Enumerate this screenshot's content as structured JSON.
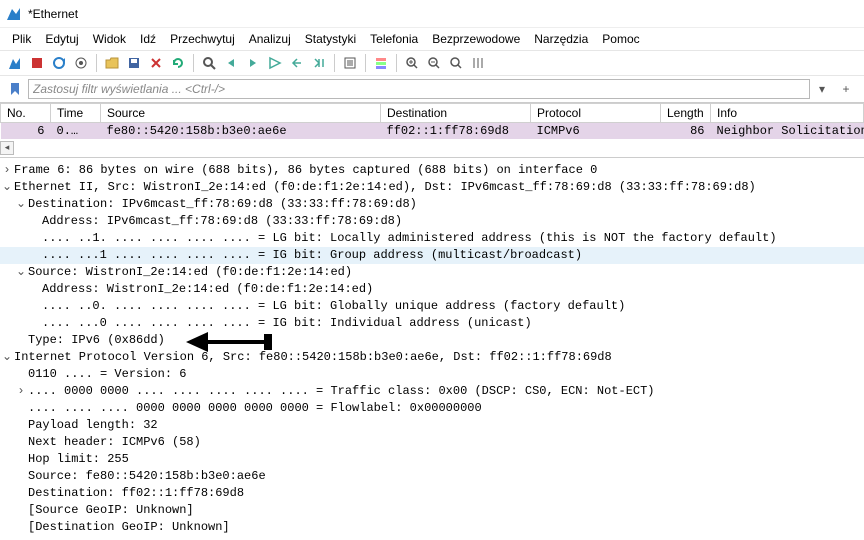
{
  "window": {
    "title": "*Ethernet"
  },
  "menu": {
    "items": [
      "Plik",
      "Edytuj",
      "Widok",
      "Idź",
      "Przechwytuj",
      "Analizuj",
      "Statystyki",
      "Telefonia",
      "Bezprzewodowe",
      "Narzędzia",
      "Pomoc"
    ]
  },
  "filter": {
    "placeholder": "Zastosuj filtr wyświetlania ... <Ctrl-/>"
  },
  "packet_table": {
    "headers": {
      "no": "No.",
      "time": "Time",
      "src": "Source",
      "dst": "Destination",
      "proto": "Protocol",
      "len": "Length",
      "info": "Info"
    },
    "rows": [
      {
        "no": "6",
        "time": "0.…",
        "src": "fe80::5420:158b:b3e0:ae6e",
        "dst": "ff02::1:ff78:69d8",
        "proto": "ICMPv6",
        "len": "86",
        "info": "Neighbor Solicitation"
      }
    ]
  },
  "details": {
    "frame_summary": "Frame 6: 86 bytes on wire (688 bits), 86 bytes captured (688 bits) on interface 0",
    "eth_summary": "Ethernet II, Src: WistronI_2e:14:ed (f0:de:f1:2e:14:ed), Dst: IPv6mcast_ff:78:69:d8 (33:33:ff:78:69:d8)",
    "eth_dst": "Destination: IPv6mcast_ff:78:69:d8 (33:33:ff:78:69:d8)",
    "eth_dst_addr": "Address: IPv6mcast_ff:78:69:d8 (33:33:ff:78:69:d8)",
    "eth_dst_lg": ".... ..1. .... .... .... .... = LG bit: Locally administered address (this is NOT the factory default)",
    "eth_dst_ig": ".... ...1 .... .... .... .... = IG bit: Group address (multicast/broadcast)",
    "eth_src": "Source: WistronI_2e:14:ed (f0:de:f1:2e:14:ed)",
    "eth_src_addr": "Address: WistronI_2e:14:ed (f0:de:f1:2e:14:ed)",
    "eth_src_lg": ".... ..0. .... .... .... .... = LG bit: Globally unique address (factory default)",
    "eth_src_ig": ".... ...0 .... .... .... .... = IG bit: Individual address (unicast)",
    "eth_type": "Type: IPv6 (0x86dd)",
    "ipv6_summary": "Internet Protocol Version 6, Src: fe80::5420:158b:b3e0:ae6e, Dst: ff02::1:ff78:69d8",
    "ipv6_ver": "0110 .... = Version: 6",
    "ipv6_tc": ".... 0000 0000 .... .... .... .... .... = Traffic class: 0x00 (DSCP: CS0, ECN: Not-ECT)",
    "ipv6_fl": ".... .... .... 0000 0000 0000 0000 0000 = Flowlabel: 0x00000000",
    "ipv6_plen": "Payload length: 32",
    "ipv6_nh": "Next header: ICMPv6 (58)",
    "ipv6_hlim": "Hop limit: 255",
    "ipv6_src": "Source: fe80::5420:158b:b3e0:ae6e",
    "ipv6_dst": "Destination: ff02::1:ff78:69d8",
    "ipv6_srcgeo": "[Source GeoIP: Unknown]",
    "ipv6_dstgeo": "[Destination GeoIP: Unknown]"
  }
}
